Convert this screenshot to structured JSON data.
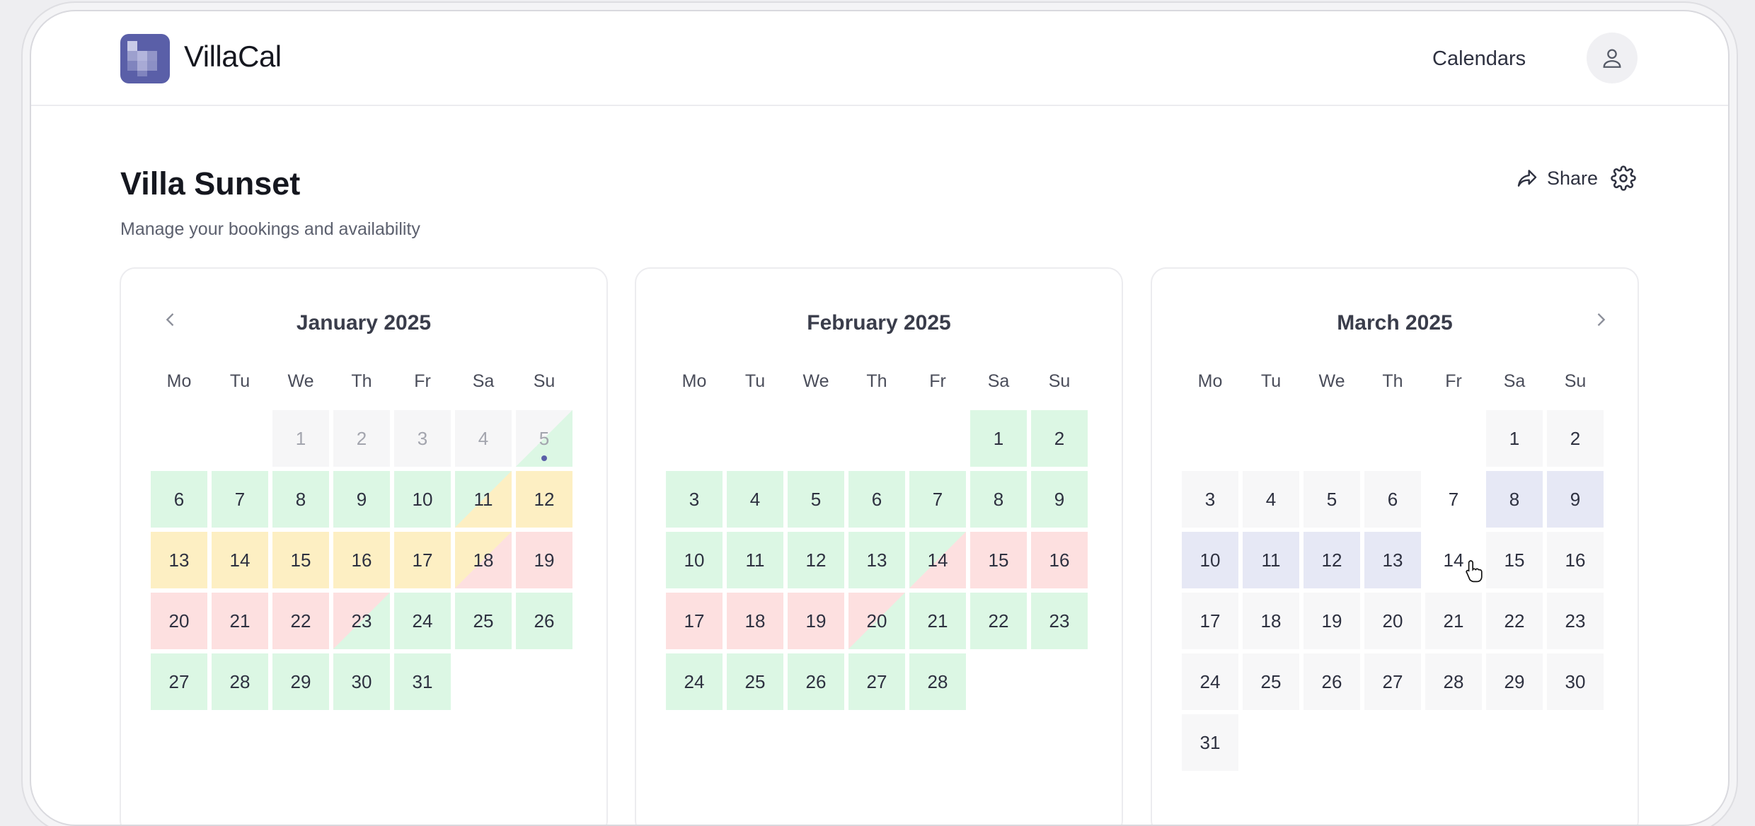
{
  "app": {
    "brand": "VillaCal",
    "nav_link": "Calendars"
  },
  "page": {
    "title": "Villa Sunset",
    "subtitle": "Manage your bookings and availability",
    "share_label": "Share"
  },
  "icons": {
    "prev": "chevron-left-icon",
    "next": "chevron-right-icon",
    "share": "share-icon",
    "settings": "gear-icon",
    "user": "user-icon",
    "logo": "villacal-logo-icon"
  },
  "colors": {
    "free": "#dcf7e4",
    "option": "#fdefc3",
    "booked": "#fde0e0",
    "past": "#f6f6f7",
    "neutral": "#f7f7f8",
    "range": "#e6e8f5",
    "range_start": "#3d4185",
    "range_end": "#5b62b0"
  },
  "weekday_labels": [
    "Mo",
    "Tu",
    "We",
    "Th",
    "Fr",
    "Sa",
    "Su"
  ],
  "months": [
    {
      "title": "January 2025",
      "first_weekday": 2,
      "days": 31,
      "status": {
        "1": "past",
        "2": "past",
        "3": "past",
        "4": "past",
        "5": "past|free",
        "6": "free",
        "7": "free",
        "8": "free",
        "9": "free",
        "10": "free",
        "11": "free|option",
        "12": "option",
        "13": "option",
        "14": "option",
        "15": "option",
        "16": "option",
        "17": "option",
        "18": "option|booked",
        "19": "booked",
        "20": "booked",
        "21": "booked",
        "22": "booked",
        "23": "booked|free",
        "24": "free",
        "25": "free",
        "26": "free",
        "27": "free",
        "28": "free",
        "29": "free",
        "30": "free",
        "31": "free"
      },
      "marked_day": 5
    },
    {
      "title": "February 2025",
      "first_weekday": 5,
      "days": 28,
      "status": {
        "1": "free",
        "2": "free",
        "3": "free",
        "4": "free",
        "5": "free",
        "6": "free",
        "7": "free",
        "8": "free",
        "9": "free",
        "10": "free",
        "11": "free",
        "12": "free",
        "13": "free",
        "14": "free|booked",
        "15": "booked",
        "16": "booked",
        "17": "booked",
        "18": "booked",
        "19": "booked",
        "20": "booked|free",
        "21": "free",
        "22": "free",
        "23": "free",
        "24": "free",
        "25": "free",
        "26": "free",
        "27": "free",
        "28": "free"
      }
    },
    {
      "title": "March 2025",
      "first_weekday": 5,
      "days": 31,
      "status": {
        "7": "range-start",
        "8": "range",
        "9": "range",
        "10": "range",
        "11": "range",
        "12": "range",
        "13": "range",
        "14": "range-end"
      },
      "default_status": "neutral"
    }
  ]
}
